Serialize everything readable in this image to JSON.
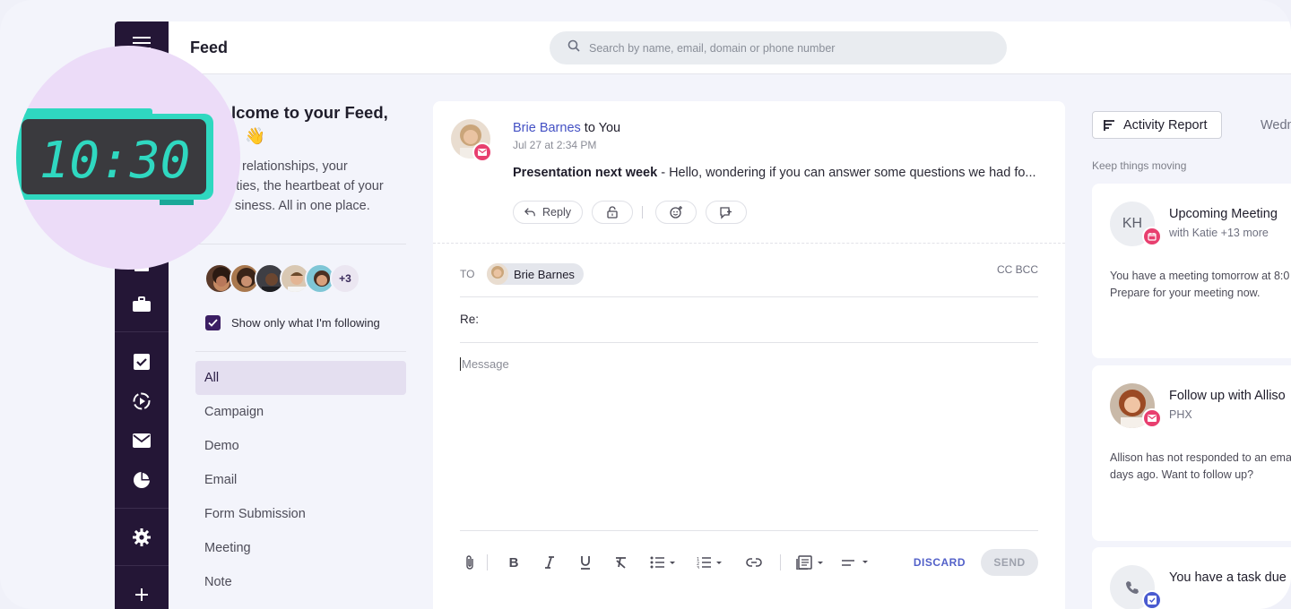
{
  "header": {
    "title": "Feed",
    "search_placeholder": "Search by name, email, domain or phone number"
  },
  "clock": {
    "time": "10:30"
  },
  "welcome": {
    "title_line1": "lcome to your Feed,",
    "title_line2": "👋",
    "body_lines": [
      "relationships, your",
      "ities, the heartbeat of your",
      "siness. All in one place."
    ]
  },
  "following": {
    "more_count": "+3",
    "label": "Show only what I'm following",
    "checked": true
  },
  "filters": [
    "All",
    "Campaign",
    "Demo",
    "Email",
    "Form Submission",
    "Meeting",
    "Note"
  ],
  "active_filter": "All",
  "post": {
    "from": "Brie Barnes",
    "to_text": "to You",
    "time": "Jul 27 at 2:34 PM",
    "subject": "Presentation next week",
    "separator": " - ",
    "preview": "Hello, wondering if you can answer some questions we had fo...",
    "reply_label": "Reply"
  },
  "compose": {
    "to_label": "TO",
    "recipient": "Brie Barnes",
    "cc_bcc": "CC BCC",
    "subject_prefix": "Re:",
    "message_placeholder": "Message",
    "discard_label": "DISCARD",
    "send_label": "SEND"
  },
  "right_panel": {
    "activity_report_label": "Activity Report",
    "day_label": "Wedn",
    "section_label": "Keep things moving",
    "cards": [
      {
        "initials": "KH",
        "title": "Upcoming Meeting",
        "subtitle": "with Katie +13 more",
        "body": [
          "You have a meeting tomorrow at 8:0",
          "Prepare for your meeting now."
        ]
      },
      {
        "title": "Follow up with Alliso",
        "subtitle": "PHX",
        "body": [
          "Allison has not responded to an ema",
          "days ago. Want to follow up?"
        ]
      },
      {
        "title": "You have a task due"
      }
    ]
  },
  "colors": {
    "nav_bg": "#241636",
    "accent_purple": "#3b1e63",
    "link_blue": "#4350c4",
    "badge_pink": "#e83f6f",
    "clock_green": "#2fd8c0"
  }
}
